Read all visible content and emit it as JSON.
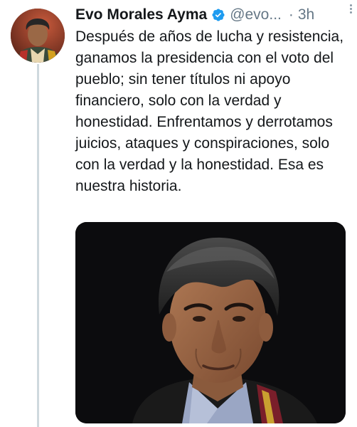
{
  "tweet": {
    "author_name": "Evo Morales Ayma",
    "handle": "@evo...",
    "separator": "·",
    "timestamp": "3h",
    "verified": true,
    "text": "Después de años de lucha y resistencia, ganamos la presidencia con el voto del pueblo; sin tener títulos ni apoyo financiero, solo con la verdad y honestidad. Enfrentamos y derrotamos juicios, ataques y conspiraciones, solo con la verdad y la honestidad. Esa es nuestra historia."
  },
  "icons": {
    "verified": "verified-badge-icon",
    "more": "more-options-icon"
  },
  "colors": {
    "verified_blue": "#1d9bf0",
    "secondary_text": "#657786",
    "thread_line": "#cfd9de"
  }
}
